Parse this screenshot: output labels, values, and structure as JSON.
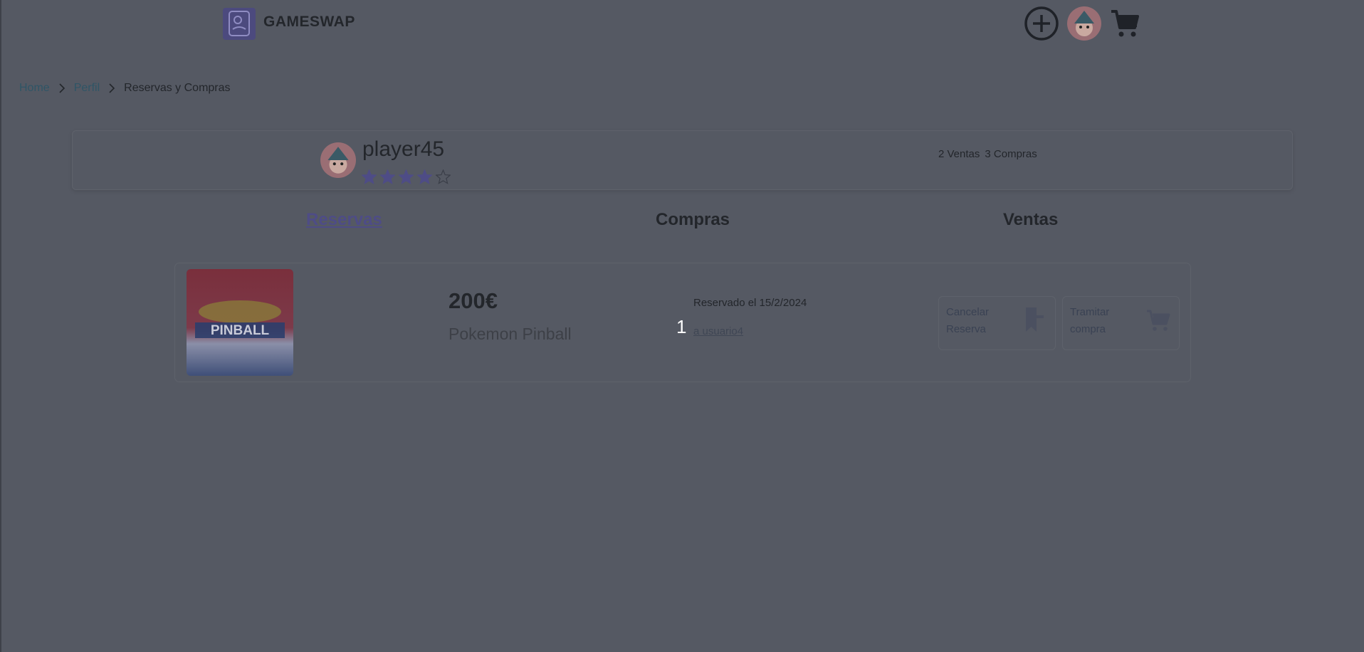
{
  "header": {
    "brand": "GAMESWAP",
    "icons": [
      "gameswap-logo-icon",
      "add-circle-icon",
      "user-avatar",
      "shopping-cart-icon"
    ]
  },
  "breadcrumb": {
    "items": [
      {
        "label": "Home"
      },
      {
        "label": "Perfil"
      },
      {
        "label": "Reservas y Compras"
      }
    ]
  },
  "profile": {
    "username": "player45",
    "rating": 4,
    "rating_max": 5,
    "sales_label": "2 Ventas",
    "purchases_label": "3 Compras"
  },
  "tabs": [
    {
      "label": "Reservas",
      "active": true
    },
    {
      "label": "Compras",
      "active": false
    },
    {
      "label": "Ventas",
      "active": false
    }
  ],
  "reservation": {
    "price": "200€",
    "game_name": "Pokemon Pinball",
    "reserved_date": "Reservado el 15/2/2024",
    "to_user": "a usuario4",
    "overlay_number": "1",
    "cancel_label": "Cancelar Reserva",
    "purchase_label": "Tramitar compra"
  },
  "colors": {
    "overlay_background": "#555963",
    "accent": "#4e4c86",
    "link": "#2f5566"
  }
}
